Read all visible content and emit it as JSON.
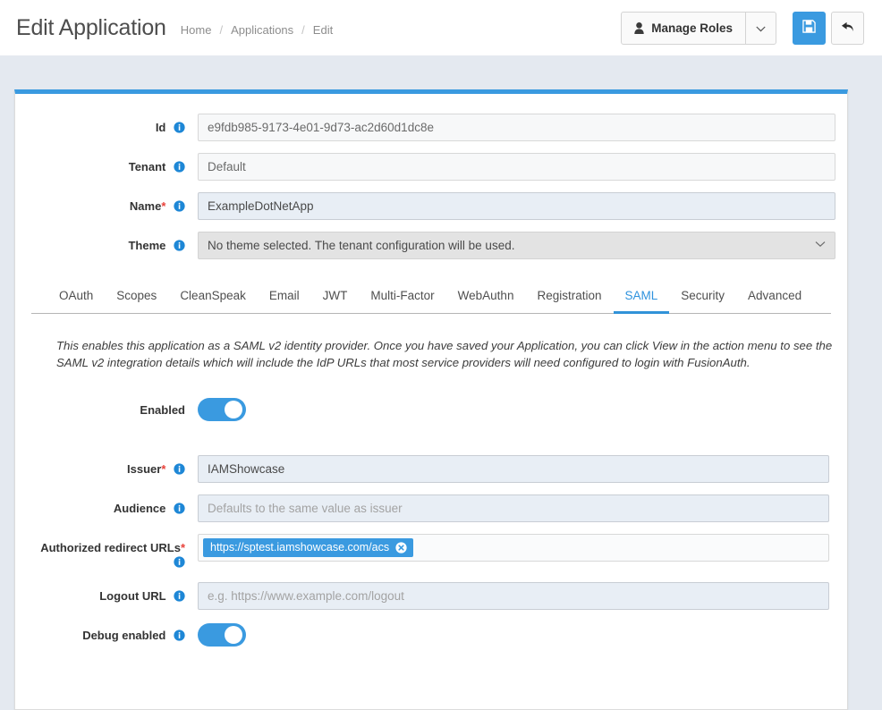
{
  "header": {
    "title": "Edit Application",
    "breadcrumb": [
      "Home",
      "Applications",
      "Edit"
    ],
    "separator": "/",
    "manage_roles_label": "Manage Roles",
    "user_icon": "user-icon",
    "caret_icon": "chevron-down-icon",
    "save_icon": "save-floppy-icon",
    "back_icon": "back-arrow-icon"
  },
  "colors": {
    "accent": "#3a9ae0",
    "tab_active": "#2f93de",
    "required": "#e8413a",
    "page_background": "#e4e9f0",
    "panel_top_border": "#3a9ae0"
  },
  "top_form": {
    "id": {
      "label": "Id",
      "value": "e9fdb985-9173-4e01-9d73-ac2d60d1dc8e",
      "required": false
    },
    "tenant": {
      "label": "Tenant",
      "value": "Default",
      "required": false
    },
    "name": {
      "label": "Name",
      "value": "ExampleDotNetApp",
      "required": true
    },
    "theme": {
      "label": "Theme",
      "value": "No theme selected. The tenant configuration will be used.",
      "required": false
    }
  },
  "tabs": [
    {
      "label": "OAuth",
      "active": false
    },
    {
      "label": "Scopes",
      "active": false
    },
    {
      "label": "CleanSpeak",
      "active": false
    },
    {
      "label": "Email",
      "active": false
    },
    {
      "label": "JWT",
      "active": false
    },
    {
      "label": "Multi-Factor",
      "active": false
    },
    {
      "label": "WebAuthn",
      "active": false
    },
    {
      "label": "Registration",
      "active": false
    },
    {
      "label": "SAML",
      "active": true
    },
    {
      "label": "Security",
      "active": false
    },
    {
      "label": "Advanced",
      "active": false
    }
  ],
  "saml": {
    "description": "This enables this application as a SAML v2 identity provider. Once you have saved your Application, you can click View in the action menu to see the SAML v2 integration details which will include the IdP URLs that most service providers will need configured to login with FusionAuth.",
    "enabled": {
      "label": "Enabled",
      "state": "on"
    },
    "issuer": {
      "label": "Issuer",
      "value": "IAMShowcase",
      "required": true
    },
    "audience": {
      "label": "Audience",
      "value": "",
      "placeholder": "Defaults to the same value as issuer",
      "required": false
    },
    "redirect_urls": {
      "label": "Authorized redirect URLs",
      "required": true,
      "chips": [
        "https://sptest.iamshowcase.com/acs"
      ],
      "remove_icon": "close-circle-icon"
    },
    "logout_url": {
      "label": "Logout URL",
      "value": "",
      "placeholder": "e.g. https://www.example.com/logout",
      "required": false
    },
    "debug_enabled": {
      "label": "Debug enabled",
      "state": "on"
    }
  }
}
